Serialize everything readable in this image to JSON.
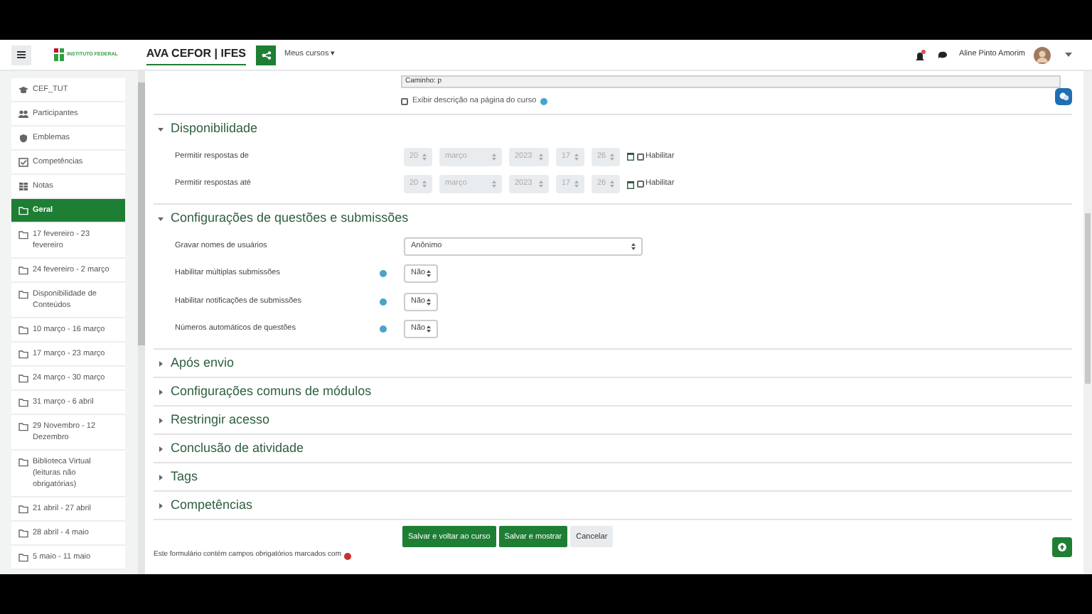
{
  "navbar": {
    "logo_text": "INSTITUTO FEDERAL",
    "site_name": "AVA CEFOR | IFES",
    "menu": "Meus cursos ▾",
    "user_name": "Aline Pinto Amorim",
    "notification": true
  },
  "sidebar": {
    "items": [
      {
        "label": "CEF_TUT",
        "kind": "course",
        "selected": false
      },
      {
        "label": "Participantes",
        "kind": "people",
        "selected": false
      },
      {
        "label": "Emblemas",
        "kind": "badge",
        "selected": false
      },
      {
        "label": "Competências",
        "kind": "check",
        "selected": false
      },
      {
        "label": "Notas",
        "kind": "table",
        "selected": false
      },
      {
        "label": "Geral",
        "kind": "folder",
        "selected": true
      },
      {
        "label": "17 fevereiro - 23 fevereiro",
        "kind": "folder",
        "selected": false
      },
      {
        "label": "24 fevereiro - 2 março",
        "kind": "folder",
        "selected": false
      },
      {
        "label": "Disponibilidade de Conteúdos",
        "kind": "folder",
        "selected": false
      },
      {
        "label": "10 março - 16 março",
        "kind": "folder",
        "selected": false
      },
      {
        "label": "17 março - 23 março",
        "kind": "folder",
        "selected": false
      },
      {
        "label": "24 março - 30 março",
        "kind": "folder",
        "selected": false
      },
      {
        "label": "31 março - 6 abril",
        "kind": "folder",
        "selected": false
      },
      {
        "label": "29 Novembro - 12 Dezembro",
        "kind": "folder",
        "selected": false
      },
      {
        "label": "Biblioteca Virtual (leituras não obrigatórias)",
        "kind": "folder",
        "selected": false
      },
      {
        "label": "21 abril - 27 abril",
        "kind": "folder",
        "selected": false
      },
      {
        "label": "28 abril - 4 maio",
        "kind": "folder",
        "selected": false
      },
      {
        "label": "5 maio - 11 maio",
        "kind": "folder",
        "selected": false
      }
    ]
  },
  "top": {
    "path_value": "Caminho: p",
    "show_description": {
      "label": "Exibir descrição na página do curso",
      "checked": false
    }
  },
  "sections": [
    {
      "title": "Disponibilidade",
      "expanded": true,
      "rows": [
        {
          "kind": "date",
          "label": "Permitir respostas de",
          "disabled": true,
          "parts": [
            "20",
            "março",
            "2023",
            "17",
            "26"
          ],
          "enable": {
            "label": "Habilitar",
            "checked": false
          }
        },
        {
          "kind": "date",
          "label": "Permitir respostas até",
          "disabled": true,
          "parts": [
            "20",
            "março",
            "2023",
            "17",
            "26"
          ],
          "enable": {
            "label": "Habilitar",
            "checked": false
          }
        }
      ]
    },
    {
      "title": "Configurações de questões e submissões",
      "expanded": true,
      "rows": [
        {
          "kind": "select",
          "label": "Gravar nomes de usuários",
          "value": "Anônimo",
          "help": false,
          "wide": true
        },
        {
          "kind": "select",
          "label": "Habilitar múltiplas submissões",
          "value": "Não",
          "help": true,
          "wide": false
        },
        {
          "kind": "select",
          "label": "Habilitar notificações de submissões",
          "value": "Não",
          "help": true,
          "wide": false
        },
        {
          "kind": "select",
          "label": "Números automáticos de questões",
          "value": "Não",
          "help": true,
          "wide": false
        }
      ]
    },
    {
      "title": "Após envio",
      "expanded": false
    },
    {
      "title": "Configurações comuns de módulos",
      "expanded": false
    },
    {
      "title": "Restringir acesso",
      "expanded": false
    },
    {
      "title": "Conclusão de atividade",
      "expanded": false
    },
    {
      "title": "Tags",
      "expanded": false
    },
    {
      "title": "Competências",
      "expanded": false
    }
  ],
  "buttons": [
    {
      "label": "Salvar e voltar ao curso",
      "kind": "primary"
    },
    {
      "label": "Salvar e mostrar",
      "kind": "primary"
    },
    {
      "label": "Cancelar",
      "kind": "secondary"
    }
  ],
  "required_note": "Este formulário contém campos obrigatórios marcados com"
}
